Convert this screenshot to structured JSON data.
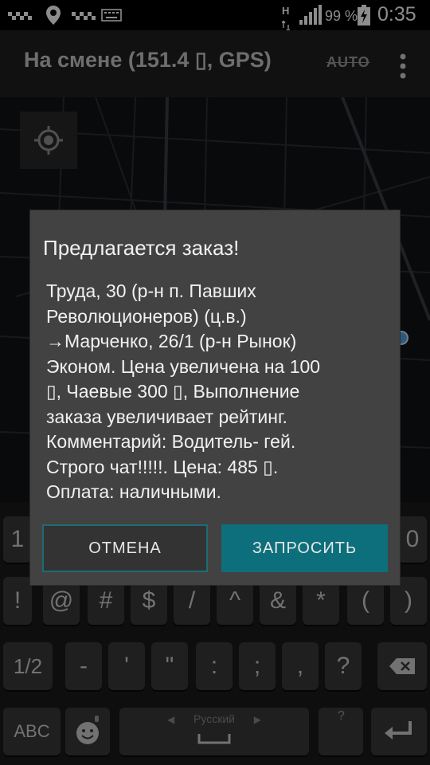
{
  "status_bar": {
    "notification_icons": [
      "taxi-icon",
      "location-pin-icon",
      "taxi-icon",
      "keyboard-icon"
    ],
    "network": "H",
    "battery_percent": "99 %",
    "time": "0:35"
  },
  "app_bar": {
    "title": "На смене (151.4 ▯, GPS)",
    "auto_label": "AUTO"
  },
  "dialog": {
    "title": "Предлагается заказ!",
    "lines": [
      "Труда, 30 (р-н п. Павших",
      "Революционеров) (ц.в.)",
      "→Марченко, 26/1 (р-н Рынок)",
      "Эконом. Цена увеличена на 100",
      "▯, Чаевые 300 ▯, Выполнение",
      "заказа увеличивает рейтинг.",
      "Комментарий: Водитель- гей.",
      "Строго чат!!!!!. Цена: 485 ▯.",
      "Оплата: наличными."
    ],
    "cancel_label": "ОТМЕНА",
    "request_label": "ЗАПРОСИТЬ"
  },
  "keyboard": {
    "row1": [
      "1",
      "0"
    ],
    "row2": [
      "!",
      "@",
      "#",
      "$",
      "/",
      "^",
      "&",
      "*",
      "(",
      ")"
    ],
    "row3": [
      "1/2",
      "-",
      "'",
      "\"",
      ":",
      ";",
      ",",
      "?"
    ],
    "row4": {
      "abc": "ABC",
      "language": "Русский",
      "small_hint": "?"
    }
  },
  "colors": {
    "accent": "#0e6f7c",
    "dialog_bg": "#424242",
    "appbar_bg": "#202020"
  }
}
